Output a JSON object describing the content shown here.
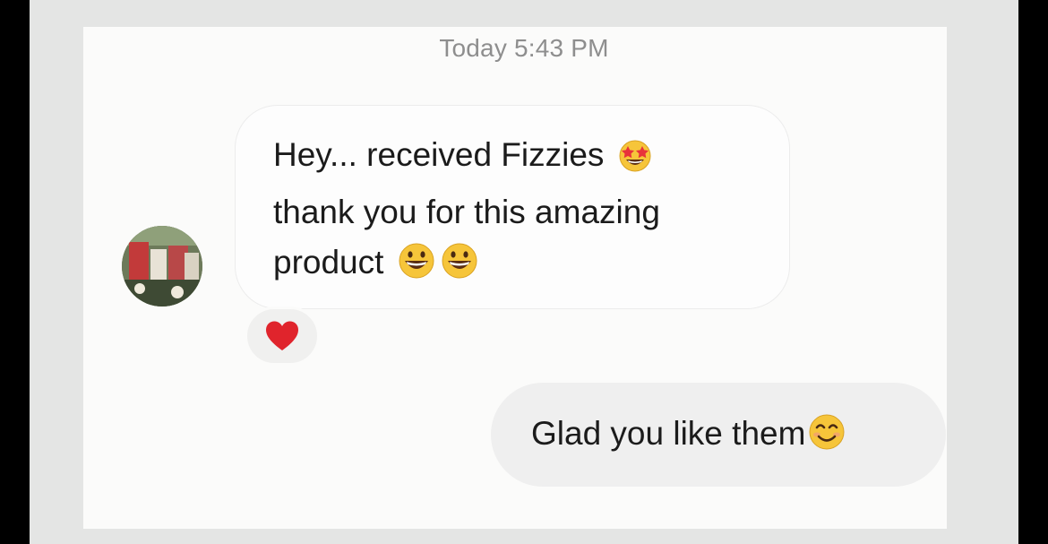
{
  "conversation": {
    "timestamp": "Today 5:43 PM",
    "incoming_message": {
      "line1": "Hey... received Fizzies",
      "line2": "thank you for this amazing",
      "line3": "product",
      "reaction": "heart-icon"
    },
    "outgoing_message": {
      "text": "Glad you like them"
    }
  },
  "icons": {
    "star_struck": "star-struck-emoji",
    "grinning": "grinning-emoji",
    "smiling": "smiling-emoji"
  },
  "colors": {
    "background": "#e4e5e4",
    "panel": "#fbfbfa",
    "outgoing_bubble": "#efefef",
    "timestamp_text": "#8e8e8e",
    "heart": "#e0242c",
    "emoji_yellow": "#f6c53a"
  }
}
